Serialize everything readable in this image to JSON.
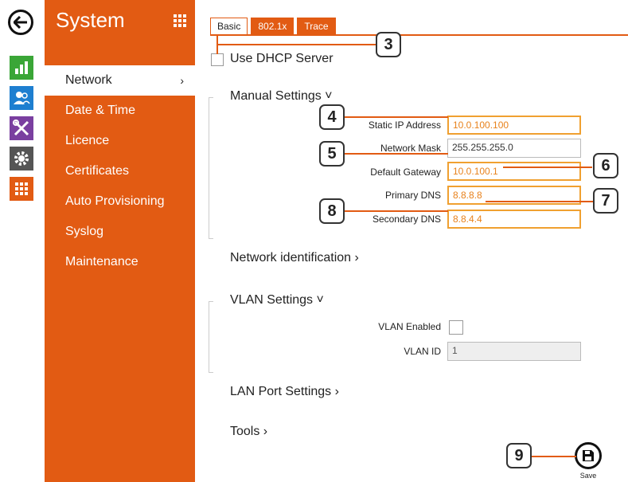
{
  "sidebar": {
    "title": "System",
    "items": [
      {
        "label": "Network",
        "chevron": "›"
      },
      {
        "label": "Date & Time"
      },
      {
        "label": "Licence"
      },
      {
        "label": "Certificates"
      },
      {
        "label": "Auto Provisioning"
      },
      {
        "label": "Syslog"
      },
      {
        "label": "Maintenance"
      }
    ]
  },
  "rail": {
    "icons": [
      "back-arrow-icon",
      "bar-chart-icon",
      "users-icon",
      "tools-icon",
      "gear-icon",
      "grid-icon"
    ],
    "colors": {
      "chart": "#3aa637",
      "users": "#1e7fd0",
      "tools": "#7a3fa0",
      "gear": "#555555",
      "grid": "#e25b13"
    }
  },
  "tabs": [
    {
      "label": "Basic"
    },
    {
      "label": "802.1x"
    },
    {
      "label": "Trace"
    }
  ],
  "dhcp": {
    "label": "Use DHCP Server"
  },
  "manual": {
    "title": "Manual Settings ˅",
    "fields": [
      {
        "label": "Static IP Address",
        "value": "10.0.100.100"
      },
      {
        "label": "Network Mask",
        "value": "255.255.255.0"
      },
      {
        "label": "Default Gateway",
        "value": "10.0.100.1"
      },
      {
        "label": "Primary DNS",
        "value": "8.8.8.8"
      },
      {
        "label": "Secondary DNS",
        "value": "8.8.4.4"
      }
    ]
  },
  "network_identification": {
    "title": "Network identification ›"
  },
  "vlan": {
    "title": "VLAN Settings ˅",
    "enabled_label": "VLAN Enabled",
    "id_label": "VLAN ID",
    "id_value": "1"
  },
  "lan_port": {
    "title": "LAN Port Settings ›"
  },
  "tools": {
    "title": "Tools ›"
  },
  "save": {
    "label": "Save"
  },
  "callouts": [
    "3",
    "4",
    "5",
    "6",
    "7",
    "8",
    "9"
  ],
  "accent": "#e25b13"
}
